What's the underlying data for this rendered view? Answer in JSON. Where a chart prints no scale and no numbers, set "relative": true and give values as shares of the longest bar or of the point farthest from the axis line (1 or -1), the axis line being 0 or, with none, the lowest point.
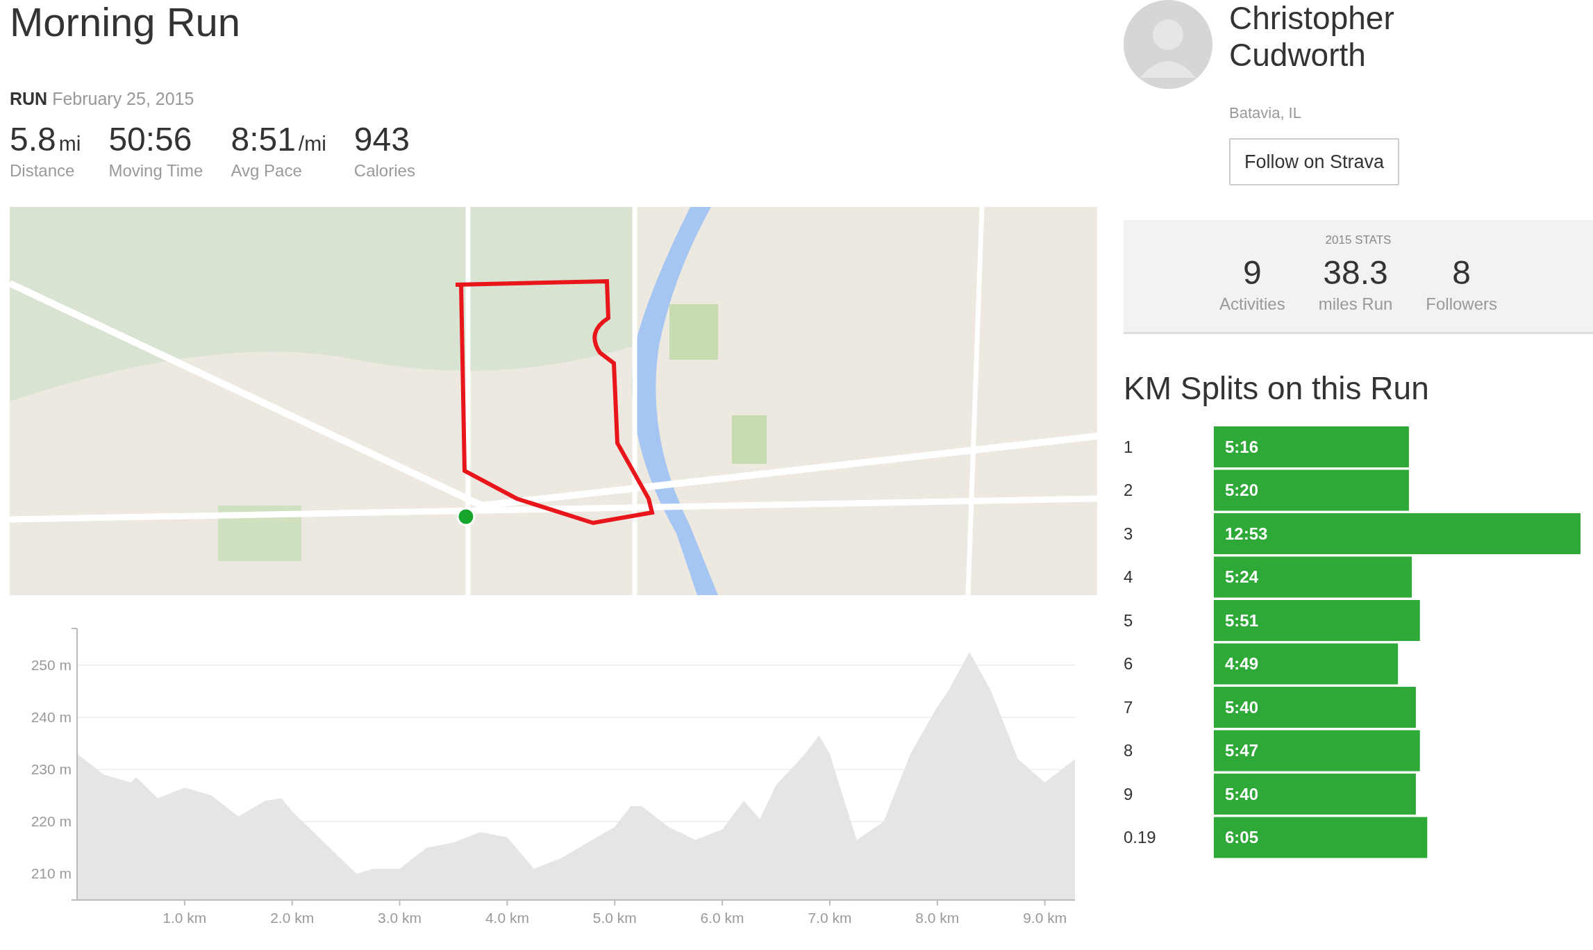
{
  "activity": {
    "title": "Morning Run",
    "type": "RUN",
    "date": "February 25, 2015",
    "stats": [
      {
        "value": "5.8",
        "unit": "mi",
        "label": "Distance"
      },
      {
        "value": "50:56",
        "label": "Moving Time"
      },
      {
        "value": "8:51",
        "unit": "/mi",
        "label": "Avg Pace"
      },
      {
        "value": "943",
        "label": "Calories"
      }
    ],
    "elevation": {
      "chart_data": {
        "type": "area",
        "x": [
          0,
          0.25,
          0.5,
          0.55,
          0.75,
          1.0,
          1.25,
          1.5,
          1.75,
          1.9,
          2.0,
          2.25,
          2.5,
          2.6,
          2.75,
          3.0,
          3.25,
          3.5,
          3.75,
          4.0,
          4.25,
          4.5,
          4.75,
          5.0,
          5.15,
          5.25,
          5.5,
          5.75,
          6.0,
          6.2,
          6.35,
          6.5,
          6.75,
          6.9,
          7.0,
          7.15,
          7.25,
          7.5,
          7.75,
          8.0,
          8.1,
          8.3,
          8.5,
          8.75,
          9.0,
          9.28
        ],
        "grid": true,
        "series": [
          {
            "color": "#e5e5e5",
            "values": [
              233,
              229,
              227.5,
              228.5,
              224.5,
              226.5,
              225,
              221,
              224,
              224.5,
              222,
              217,
              212,
              210,
              211,
              211,
              215,
              216,
              218,
              217,
              211,
              213,
              216,
              219,
              223,
              223,
              219,
              216.5,
              218.5,
              224,
              220.5,
              227,
              232.5,
              236.5,
              233,
              223,
              216.5,
              220,
              233,
              242,
              245,
              252.5,
              245,
              232,
              227.5,
              232
            ]
          }
        ],
        "xlim": [
          0,
          9.28
        ],
        "ylim": [
          205,
          257
        ],
        "xticks": [
          {
            "value": 1,
            "label": "1.0 km"
          },
          {
            "value": 2,
            "label": "2.0 km"
          },
          {
            "value": 3,
            "label": "3.0 km"
          },
          {
            "value": 4,
            "label": "4.0 km"
          },
          {
            "value": 5,
            "label": "5.0 km"
          },
          {
            "value": 6,
            "label": "6.0 km"
          },
          {
            "value": 7,
            "label": "7.0 km"
          },
          {
            "value": 8,
            "label": "8.0 km"
          },
          {
            "value": 9,
            "label": "9.0 km"
          }
        ],
        "yticks": [
          {
            "value": 210,
            "label": "210 m"
          },
          {
            "value": 220,
            "label": "220 m"
          },
          {
            "value": 230,
            "label": "230 m"
          },
          {
            "value": 240,
            "label": "240 m"
          },
          {
            "value": 250,
            "label": "250 m"
          }
        ]
      }
    }
  },
  "athlete": {
    "name": "Christopher Cudworth",
    "location": "Batavia, IL",
    "follow_button": "Follow on Strava"
  },
  "year_stats": {
    "title": "2015 STATS",
    "items": [
      {
        "value": "9",
        "label": "Activities"
      },
      {
        "value": "38.3",
        "label": "miles Run"
      },
      {
        "value": "8",
        "label": "Followers"
      }
    ]
  },
  "splits": {
    "chart_data": {
      "type": "bar",
      "orientation": "horizontal",
      "title": "KM Splits on this Run",
      "categories": [
        "1",
        "2",
        "3",
        "4",
        "5",
        "6",
        "7",
        "8",
        "9",
        "0.19"
      ],
      "relative": true,
      "series": [
        {
          "color": "#2ea836",
          "values": [
            0.532,
            0.532,
            1.0,
            0.54,
            0.562,
            0.502,
            0.551,
            0.562,
            0.551,
            0.582
          ]
        }
      ],
      "value_labels": [
        "5:16",
        "5:20",
        "12:53",
        "5:24",
        "5:51",
        "4:49",
        "5:40",
        "5:47",
        "5:40",
        "6:05"
      ]
    }
  }
}
